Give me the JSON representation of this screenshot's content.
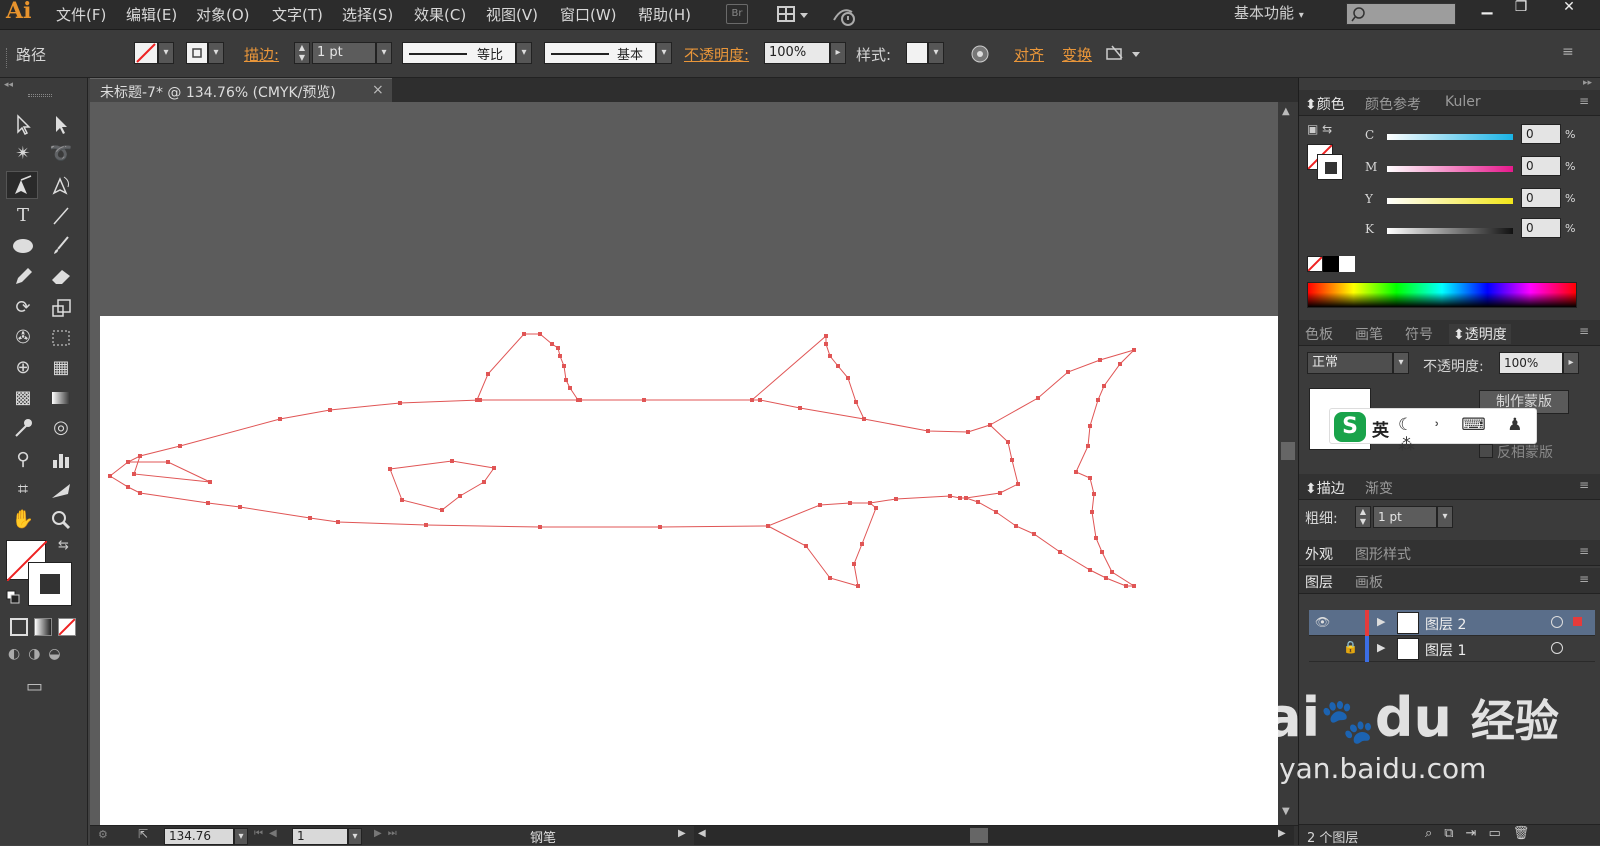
{
  "app": {
    "logo": "Ai"
  },
  "menu": [
    "文件(F)",
    "编辑(E)",
    "对象(O)",
    "文字(T)",
    "选择(S)",
    "效果(C)",
    "视图(V)",
    "窗口(W)",
    "帮助(H)"
  ],
  "menubar": {
    "br_icon": "Br",
    "workspace": "基本功能",
    "search_placeholder": ""
  },
  "control": {
    "selection": "路径",
    "stroke_label": "描边:",
    "stroke_weight": "1 pt",
    "profile_equal": "等比",
    "brush_basic": "基本",
    "opacity_label": "不透明度:",
    "opacity_value": "100%",
    "style_label": "样式:",
    "align_label": "对齐",
    "transform_label": "变换"
  },
  "document": {
    "tab_title": "未标题-7* @ 134.76% (CMYK/预览)",
    "close_symbol": "×"
  },
  "status": {
    "zoom": "134.76",
    "artboard_index": "1",
    "current_tool": "钢笔"
  },
  "color_panel": {
    "tabs": [
      "颜色",
      "颜色参考",
      "Kuler"
    ],
    "channels": [
      {
        "name": "C",
        "value": "0",
        "color": "#19b3e6"
      },
      {
        "name": "M",
        "value": "0",
        "color": "#e6198c"
      },
      {
        "name": "Y",
        "value": "0",
        "color": "#f2e619"
      },
      {
        "name": "K",
        "value": "0",
        "color": "#111111"
      }
    ],
    "unit": "%"
  },
  "swatch_panel": {
    "tabs": [
      "色板",
      "画笔",
      "符号",
      "透明度"
    ]
  },
  "transparency": {
    "blend_mode": "正常",
    "opacity_label": "不透明度:",
    "opacity_value": "100%",
    "make_mask": "制作蒙版",
    "invert_mask": "反相蒙版",
    "ime_char": "英"
  },
  "stroke_panel": {
    "tabs": [
      "描边",
      "渐变"
    ],
    "weight_label": "粗细:",
    "weight_value": "1 pt"
  },
  "appearance_panel": {
    "tabs": [
      "外观",
      "图形样式"
    ]
  },
  "layers_panel": {
    "tabs": [
      "图层",
      "画板"
    ],
    "layers": [
      {
        "name": "图层 2",
        "color": "#e53b3b"
      },
      {
        "name": "图层 1",
        "color": "#3b6ee5"
      }
    ],
    "count": "2 个图层"
  },
  "watermark": {
    "brand": "Bai",
    "brand2": "du",
    "cn": "经验",
    "url": "jingyan.baidu.com"
  },
  "colors": {
    "path_red": "#e05555",
    "accent_orange": "#e9963a"
  }
}
